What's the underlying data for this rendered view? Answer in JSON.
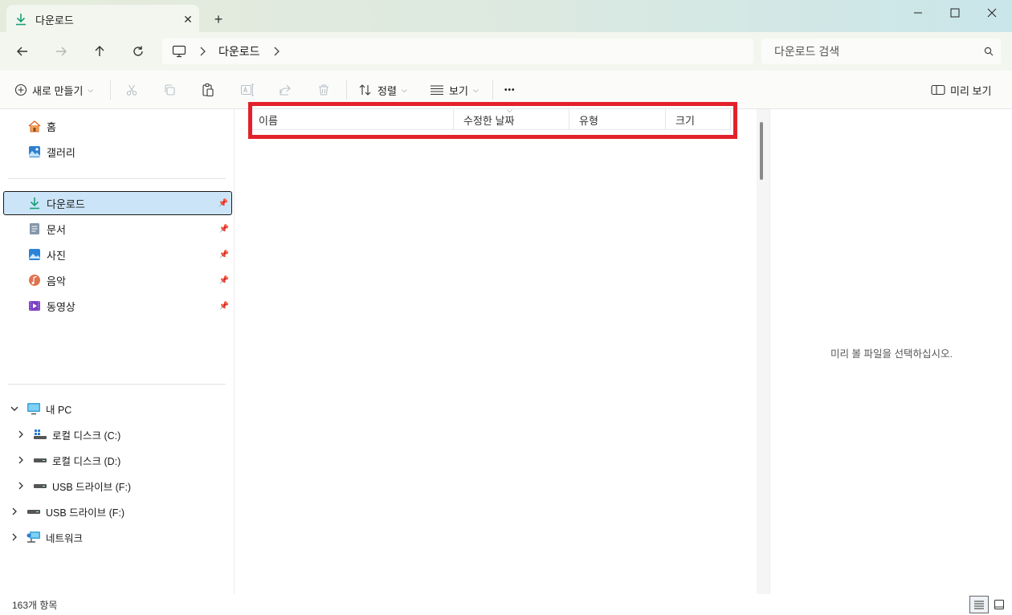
{
  "window": {
    "tab_title": "다운로드",
    "tab_close": "✕",
    "new_tab": "+"
  },
  "address": {
    "segments": [
      "다운로드"
    ],
    "search_placeholder": "다운로드 검색"
  },
  "toolbar": {
    "new_label": "새로 만들기",
    "sort_label": "정렬",
    "view_label": "보기",
    "more_label": "•••",
    "preview_label": "미리 보기"
  },
  "sidebar": {
    "quick": [
      {
        "label": "홈"
      },
      {
        "label": "갤러리"
      }
    ],
    "pinned": [
      {
        "label": "다운로드"
      },
      {
        "label": "문서"
      },
      {
        "label": "사진"
      },
      {
        "label": "음악"
      },
      {
        "label": "동영상"
      }
    ],
    "tree": {
      "this_pc": "내 PC",
      "drives": [
        {
          "label": "로컬 디스크 (C:)"
        },
        {
          "label": "로컬 디스크 (D:)"
        },
        {
          "label": "USB 드라이브 (F:)"
        }
      ],
      "usb_root": "USB 드라이브 (F:)",
      "network": "네트워크"
    }
  },
  "main": {
    "columns": [
      "이름",
      "수정한 날짜",
      "유형",
      "크기"
    ]
  },
  "preview": {
    "message": "미리 볼 파일을 선택하십시오."
  },
  "status": {
    "item_count": "163개 항목"
  }
}
